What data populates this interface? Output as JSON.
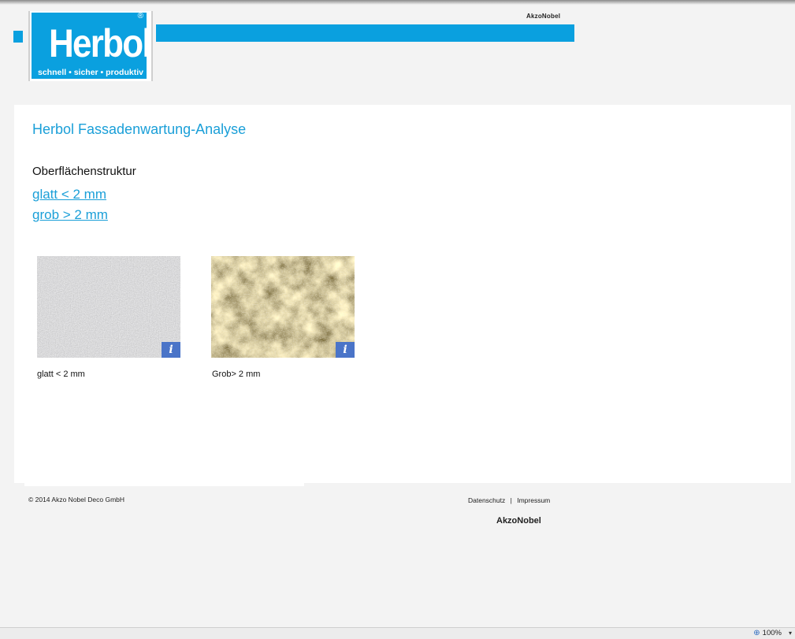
{
  "header": {
    "akzo_label": "AkzoNobel",
    "logo": {
      "word": "Herbol",
      "registered": "®",
      "tagline": "schnell • sicher • produktiv"
    },
    "brand_color": "#0aa0df"
  },
  "main": {
    "title": "Herbol Fassadenwartung-Analyse",
    "section_label": "Oberflächenstruktur",
    "links": [
      "glatt < 2 mm",
      "grob > 2 mm"
    ],
    "tiles": [
      {
        "caption": "glatt < 2 mm",
        "info_icon": "info-icon",
        "info_glyph": "i"
      },
      {
        "caption": "Grob> 2 mm",
        "info_icon": "info-icon",
        "info_glyph": "i"
      }
    ]
  },
  "footer": {
    "copyright": "© 2014 Akzo Nobel Deco GmbH",
    "privacy": "Datenschutz",
    "separator": "|",
    "imprint": "Impressum",
    "akzo_label": "AkzoNobel"
  },
  "status_bar": {
    "zoom_icon": "zoom-icon",
    "zoom_level": "100%"
  }
}
